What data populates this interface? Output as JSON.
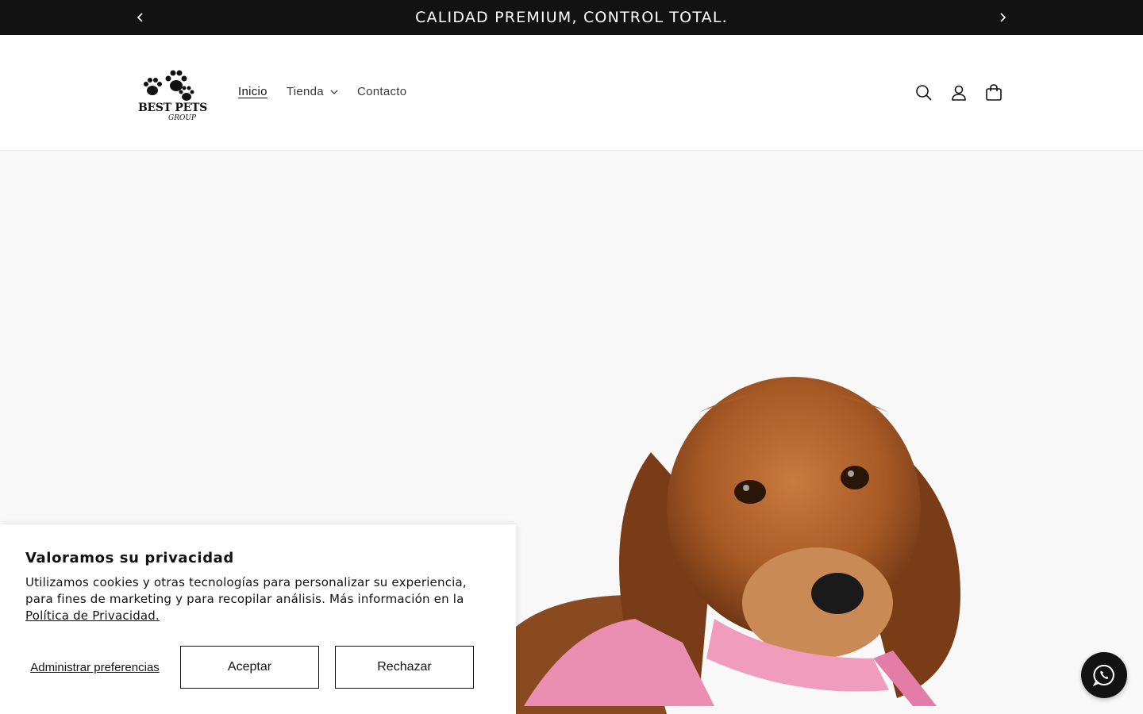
{
  "announcement": {
    "text": "CALIDAD PREMIUM, CONTROL TOTAL.",
    "prev_icon": "chevron-left-icon",
    "next_icon": "chevron-right-icon"
  },
  "header": {
    "logo_text": "BEST PETS",
    "logo_subtext": "GROUP",
    "nav": [
      {
        "label": "Inicio",
        "active": true
      },
      {
        "label": "Tienda",
        "has_dropdown": true
      },
      {
        "label": "Contacto"
      }
    ],
    "icons": [
      "search-icon",
      "account-icon",
      "cart-icon"
    ]
  },
  "cookie": {
    "title": "Valoramos su privacidad",
    "body": "Utilizamos cookies y otras tecnologías para personalizar su experiencia, para fines de marketing y para recopilar análisis. Más información en la",
    "link": "Política de Privacidad.",
    "manage_label": "Administrar preferencias",
    "accept_label": "Aceptar",
    "reject_label": "Rechazar"
  },
  "colors": {
    "announcement_bg": "#121212",
    "text": "#121212",
    "hero_bg": "#f8f8f8"
  }
}
